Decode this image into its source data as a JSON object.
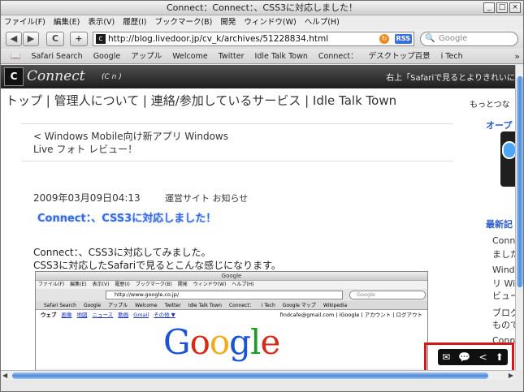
{
  "window": {
    "title": "Connect：Connect：、CSS3に対応しました！",
    "buttons": [
      "_",
      "□",
      "×"
    ]
  },
  "menu": [
    "ファイル(F)",
    "編集(E)",
    "表示(V)",
    "履歴(I)",
    "ブックマーク(B)",
    "開発",
    "ウィンドウ(W)",
    "ヘルプ(H)"
  ],
  "toolbar": {
    "back": "◀",
    "forward": "▶",
    "reload": "C",
    "add": "+",
    "url": "http://blog.livedoor.jp/cv_k/archives/51228834.html",
    "rss": "RSS",
    "search_placeholder": "Google"
  },
  "bookmarks": [
    "Safari Search",
    "Google",
    "アップル",
    "Welcome",
    "Twitter",
    "Idle Talk Town",
    "Connect：",
    "デスクトップ百景",
    "i Tech"
  ],
  "page": {
    "logo_letter": "C",
    "logo_text": "Connect",
    "logo_sub": "(C n )",
    "header_right": "右上「Safariで見るとよりきれいに",
    "nav": "トップ | 管理人について | 連絡/参加しているサービス | Idle Talk Town",
    "side_top": "もっとつな",
    "prev_link": "< Windows Mobile向け新アプリ Windows Live フォト レビュー！",
    "date": "2009年03月09日04:13",
    "categories": "運営サイト  お知らせ",
    "post_title": "Connect：、CSS3に対応しました！",
    "body": [
      "Connect：、CSS3に対応してみました。",
      "CSS3に対応したSafariで見るとこんな感じになります。"
    ],
    "side_heading1": "オープ",
    "side_heading2": "最新記",
    "side_items": [
      "Conn",
      "ました",
      "Wind",
      "リ Wi",
      "ビュー",
      "ブログ",
      "もので",
      "Conn"
    ]
  },
  "embedded": {
    "title": "Google",
    "menu": [
      "ファイル(F)",
      "編集(E)",
      "表示(V)",
      "履歴(I)",
      "ブックマーク(B)",
      "開発",
      "ウィンドウ(W)",
      "ヘルプ(H)"
    ],
    "url": "http://www.google.co.jp/",
    "search": "Google",
    "bookmarks": [
      "Safari Search",
      "Google",
      "アップル",
      "Welcome",
      "Twitter",
      "Idle Talk Town",
      "Connect：",
      "i Tech",
      "Google マップ",
      "Wikipedia"
    ],
    "links": [
      "ウェブ",
      "画像",
      "地図",
      "ニュース",
      "動画",
      "Gmail",
      "その他 ▼"
    ],
    "account": "findcafe@gmail.com | iGoogle | アカウント | ログアウト",
    "logo": [
      "G",
      "o",
      "o",
      "g",
      "l",
      "e"
    ]
  },
  "share": [
    "✉",
    "💬",
    "<",
    "⬆"
  ]
}
